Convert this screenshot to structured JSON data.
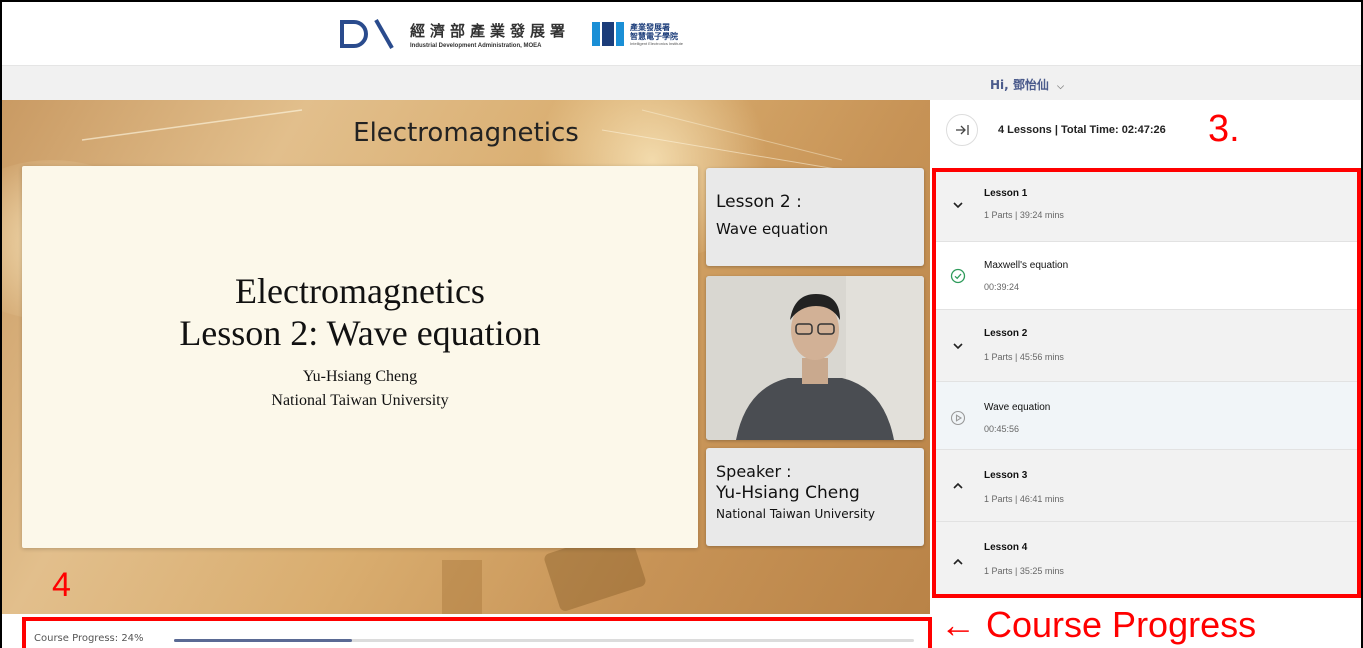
{
  "header": {
    "ida_name_zh": "經濟部產業發展署",
    "ida_name_en": "Industrial Development Administration, MOEA",
    "iei_name_zh_line1": "產業發展署",
    "iei_name_zh_line2": "智慧電子學院",
    "iei_name_en": "Intelligent Electronics Institute"
  },
  "user": {
    "greeting": "Hi, 鄧怡仙"
  },
  "video": {
    "title": "Electromagnetics",
    "slide_line1": "Electromagnetics",
    "slide_line2": "Lesson 2: Wave equation",
    "slide_author": "Yu-Hsiang Cheng",
    "slide_affiliation": "National Taiwan University",
    "lesson_card_line1": "Lesson 2 :",
    "lesson_card_line2": "Wave equation",
    "speaker_card_line1": "Speaker :",
    "speaker_card_line2": "Yu-Hsiang Cheng",
    "speaker_card_line3": "National Taiwan University"
  },
  "progress": {
    "label": "Course Progress: 24%",
    "value_percent": 24
  },
  "panel": {
    "summary": "4 Lessons | Total Time: 02:47:26"
  },
  "lessons": [
    {
      "title": "Lesson 1",
      "meta": "1 Parts | 39:24 mins",
      "expanded": true,
      "parts": [
        {
          "title": "Maxwell's equation",
          "duration": "00:39:24",
          "status": "completed"
        }
      ]
    },
    {
      "title": "Lesson 2",
      "meta": "1 Parts | 45:56 mins",
      "expanded": true,
      "parts": [
        {
          "title": "Wave equation",
          "duration": "00:45:56",
          "status": "playing"
        }
      ]
    },
    {
      "title": "Lesson 3",
      "meta": "1 Parts | 46:41 mins",
      "expanded": false,
      "parts": []
    },
    {
      "title": "Lesson 4",
      "meta": "1 Parts | 35:25 mins",
      "expanded": false,
      "parts": []
    }
  ],
  "annotations": {
    "panel_marker": "3.",
    "progress_marker": "4",
    "progress_caption": "← Course Progress"
  },
  "colors": {
    "annotation_red": "#ff0000",
    "accent_blue": "#4b5b8c",
    "completed_green": "#2e9b5b"
  }
}
